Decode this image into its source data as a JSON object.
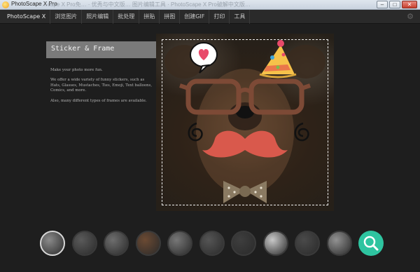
{
  "window": {
    "title": "PhotoScape X Pro",
    "ghost_title": "…cape X Pro免… · 优秀与中文版… 图片编辑工具 · PhotoScape X Pro破解中文版…",
    "buttons": {
      "minimize": "–",
      "maximize": "□",
      "close": "✕"
    }
  },
  "menu": {
    "brand": "PhotoScape X",
    "items": [
      "浏览图片",
      "照片编辑",
      "批处理",
      "拼贴",
      "拼图",
      "创建GIF",
      "打印",
      "工具"
    ]
  },
  "info": {
    "title": "Sticker & Frame",
    "paragraphs": [
      "Make your photo more fun.",
      "We offer a wide variety of funny stickers, such as Hats, Glasses, Mustaches, Ties, Emoji, Text balloons, Comics, and more.",
      "Also, many different types of frames are available."
    ]
  },
  "thumbnails": [
    {
      "name": "thumb-1",
      "tone": "#8a8a8a",
      "selected": true
    },
    {
      "name": "thumb-2",
      "tone": "#5a5a5a",
      "selected": false
    },
    {
      "name": "thumb-3",
      "tone": "#6e6e6e",
      "selected": false
    },
    {
      "name": "thumb-4",
      "tone": "#6b4a33",
      "selected": false
    },
    {
      "name": "thumb-5",
      "tone": "#777777",
      "selected": false
    },
    {
      "name": "thumb-6",
      "tone": "#555555",
      "selected": false
    },
    {
      "name": "thumb-7",
      "tone": "#3e3e3e",
      "selected": false
    },
    {
      "name": "thumb-8",
      "tone": "#c8c8c8",
      "selected": false
    },
    {
      "name": "thumb-9",
      "tone": "#4a4a4a",
      "selected": false
    },
    {
      "name": "thumb-10",
      "tone": "#929292",
      "selected": false
    }
  ],
  "search_thumb": {
    "icon": "search-icon",
    "color": "#2ec4a0"
  },
  "colors": {
    "accent": "#2ec4a0",
    "header": "#7a7a7a"
  }
}
